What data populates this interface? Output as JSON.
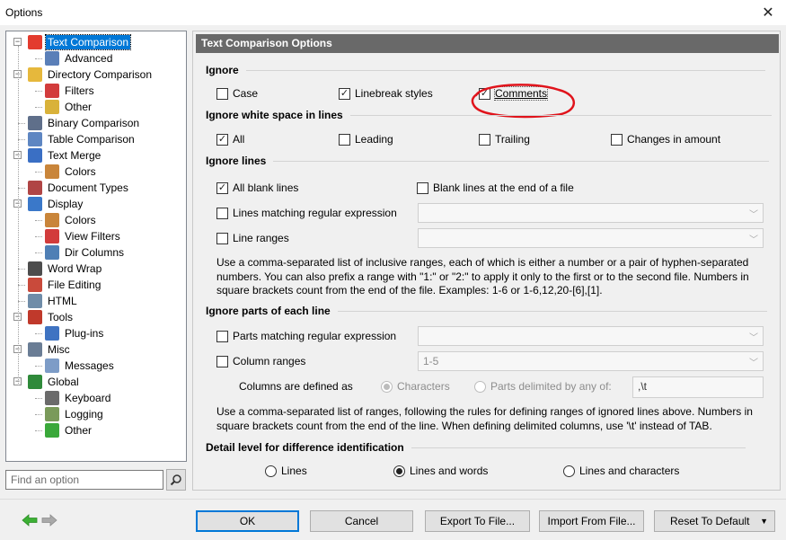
{
  "window": {
    "title": "Options",
    "close_glyph": "✕"
  },
  "tree": {
    "items": [
      {
        "label": "Text Comparison",
        "icon": "text-compare-icon",
        "level": 0,
        "selected": true,
        "expander": "−"
      },
      {
        "label": "Advanced",
        "icon": "advanced-icon",
        "level": 1
      },
      {
        "label": "Directory Comparison",
        "icon": "folder-compare-icon",
        "level": 0,
        "expander": "−"
      },
      {
        "label": "Filters",
        "icon": "filter-icon",
        "level": 1
      },
      {
        "label": "Other",
        "icon": "other-folder-icon",
        "level": 1
      },
      {
        "label": "Binary Comparison",
        "icon": "binary-icon",
        "level": 0
      },
      {
        "label": "Table Comparison",
        "icon": "table-icon",
        "level": 0
      },
      {
        "label": "Text Merge",
        "icon": "merge-icon",
        "level": 0,
        "expander": "−"
      },
      {
        "label": "Colors",
        "icon": "palette-icon",
        "level": 1
      },
      {
        "label": "Document Types",
        "icon": "document-types-icon",
        "level": 0
      },
      {
        "label": "Display",
        "icon": "monitor-icon",
        "level": 0,
        "expander": "−"
      },
      {
        "label": "Colors",
        "icon": "palette-icon",
        "level": 1
      },
      {
        "label": "View Filters",
        "icon": "filter-icon",
        "level": 1
      },
      {
        "label": "Dir Columns",
        "icon": "columns-icon",
        "level": 1
      },
      {
        "label": "Word Wrap",
        "icon": "word-wrap-icon",
        "level": 0
      },
      {
        "label": "File Editing",
        "icon": "edit-icon",
        "level": 0
      },
      {
        "label": "HTML",
        "icon": "html-icon",
        "level": 0
      },
      {
        "label": "Tools",
        "icon": "tools-icon",
        "level": 0,
        "expander": "−"
      },
      {
        "label": "Plug-ins",
        "icon": "plugin-icon",
        "level": 1
      },
      {
        "label": "Misc",
        "icon": "misc-icon",
        "level": 0,
        "expander": "−"
      },
      {
        "label": "Messages",
        "icon": "message-icon",
        "level": 1
      },
      {
        "label": "Global",
        "icon": "globe-icon",
        "level": 0,
        "expander": "−"
      },
      {
        "label": "Keyboard",
        "icon": "keyboard-icon",
        "level": 1
      },
      {
        "label": "Logging",
        "icon": "logging-icon",
        "level": 1
      },
      {
        "label": "Other",
        "icon": "cube-icon",
        "level": 1
      }
    ]
  },
  "search": {
    "placeholder": "Find an option",
    "icon": "search-icon"
  },
  "panel": {
    "header": "Text Comparison Options",
    "ignore": {
      "title": "Ignore",
      "case": {
        "label": "Case",
        "checked": false
      },
      "linebreak": {
        "label": "Linebreak styles",
        "checked": true
      },
      "comments": {
        "label": "Comments",
        "checked": true
      }
    },
    "whitespace": {
      "title": "Ignore white space in lines",
      "all": {
        "label": "All",
        "checked": true
      },
      "leading": {
        "label": "Leading",
        "checked": false
      },
      "trailing": {
        "label": "Trailing",
        "checked": false
      },
      "changes": {
        "label": "Changes in amount",
        "checked": false
      }
    },
    "lines": {
      "title": "Ignore lines",
      "blank": {
        "label": "All blank lines",
        "checked": true
      },
      "blank_end": {
        "label": "Blank lines at the end of a file",
        "checked": false
      },
      "regex": {
        "label": "Lines matching regular expression",
        "checked": false,
        "value": ""
      },
      "ranges": {
        "label": "Line ranges",
        "checked": false,
        "value": ""
      },
      "help": "Use a comma-separated list of inclusive ranges, each of which is either a number or a pair of hyphen-separated numbers. You can also prefix a range with \"1:\" or \"2:\" to apply it only to the first or to the second file. Numbers in square brackets count from the end of the file. Examples: 1-6 or 1-6,12,20-[6],[1]."
    },
    "parts": {
      "title": "Ignore parts of each line",
      "regex": {
        "label": "Parts matching regular expression",
        "checked": false,
        "value": ""
      },
      "columns": {
        "label": "Column ranges",
        "checked": false,
        "value": "1-5"
      },
      "defined_as": "Columns are defined as",
      "characters": {
        "label": "Characters",
        "selected": true
      },
      "delimited": {
        "label": "Parts delimited by any of:",
        "selected": false
      },
      "delimiter": ",\\t",
      "help": "Use a comma-separated list of ranges, following the rules for defining ranges of ignored lines above. Numbers in square brackets count from the end of the line. When defining delimited columns, use '\\t' instead of TAB."
    },
    "detail": {
      "title": "Detail level for difference identification",
      "lines": {
        "label": "Lines",
        "selected": false
      },
      "words": {
        "label": "Lines and words",
        "selected": true
      },
      "chars": {
        "label": "Lines and characters",
        "selected": false
      }
    }
  },
  "buttons": {
    "ok": "OK",
    "cancel": "Cancel",
    "export": "Export To File...",
    "import": "Import From File...",
    "reset": "Reset To Default",
    "reset_arrow": "▼"
  },
  "nav": {
    "back_icon": "arrow-left-icon",
    "forward_icon": "arrow-right-icon"
  },
  "colors": {
    "selection": "#0078d7",
    "header_bg": "#696969",
    "annotation": "#e0131b",
    "back_arrow": "#3cb034"
  }
}
